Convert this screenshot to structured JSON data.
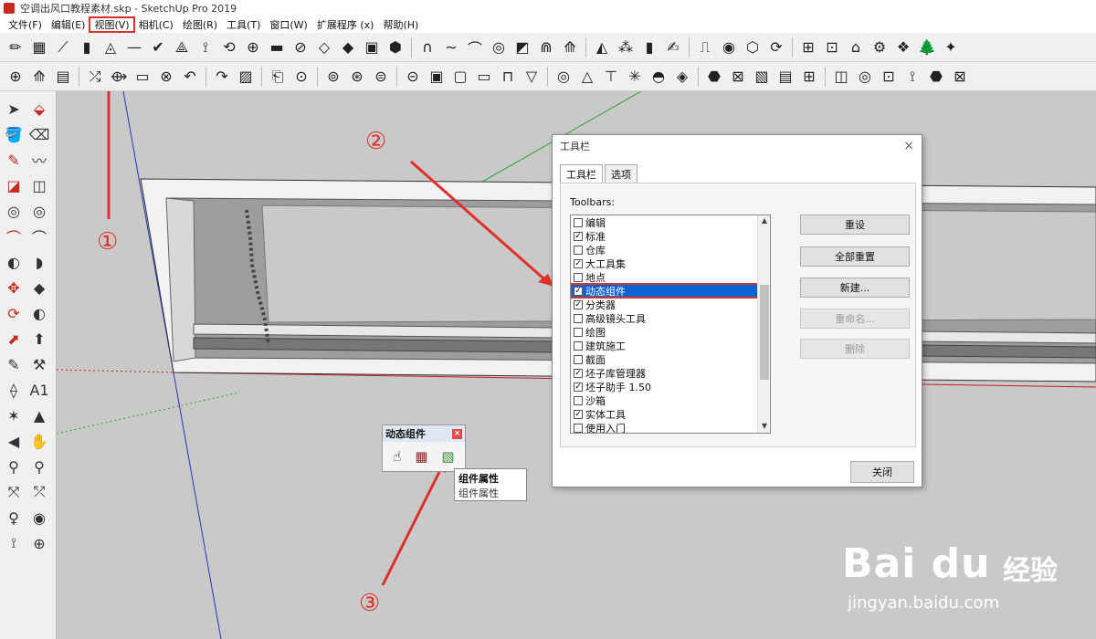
{
  "window": {
    "title": "空调出风口教程素材.skp - SketchUp Pro 2019"
  },
  "menu": {
    "items": [
      "文件(F)",
      "编辑(E)",
      "视图(V)",
      "相机(C)",
      "绘图(R)",
      "工具(T)",
      "窗口(W)",
      "扩展程序 (x)",
      "帮助(H)"
    ],
    "active_index": 2
  },
  "toolbar_row1": [
    "✏",
    "▦",
    "⟋",
    "▮",
    "◬",
    "—",
    "✔",
    "⟁",
    "⟟",
    "⟲",
    "⊕",
    "▬",
    "⊘",
    "◇",
    "◆",
    "▣",
    "⬢",
    "∩",
    "∼",
    "⌒",
    "◎",
    "◩",
    "⋒",
    "⟰",
    "◭",
    "⁂",
    "▮",
    "✍",
    "⎍",
    "◉",
    "⬡",
    "⟳",
    "⊞",
    "⊡",
    "⌂",
    "⚙",
    "❖",
    "🌲",
    "✦"
  ],
  "toolbar_row2": [
    "⊕",
    "⟰",
    "▤",
    "⤮",
    "⟴",
    "▭",
    "⊗",
    "↶",
    "↷",
    "▨",
    "⎗",
    "⊙",
    "⊚",
    "⊛",
    "⊜",
    "⊝",
    "▣",
    "▢",
    "▭",
    "⊓",
    "▽",
    "◎",
    "△",
    "⊤",
    "✳",
    "◓",
    "◈",
    "⬣",
    "⊠",
    "▧",
    "▤",
    "⊞",
    "◫",
    "◎",
    "⊡",
    "⟟",
    "⬣",
    "⊠"
  ],
  "left_tools": [
    "➤",
    "⬙",
    "🪣",
    "⌫",
    "✎",
    "〰",
    "◪",
    "◫",
    "◎",
    "◎",
    "⌒",
    "⌒",
    "◐",
    "◗",
    "✥",
    "◆",
    "⟳",
    "◐",
    "⬈",
    "⬆",
    "✎",
    "⚒",
    "⟠",
    "A1",
    "✶",
    "▲",
    "◀",
    "✋",
    "⚲",
    "⚲",
    "⤧",
    "⤱",
    "♀",
    "◉",
    "⟟",
    "⊕"
  ],
  "dynamic_components": {
    "title": "动态组件",
    "close": "×",
    "icons": [
      "interact-icon",
      "component-options-icon",
      "component-attributes-icon"
    ],
    "tooltip_title": "组件属性",
    "tooltip_desc": "组件属性"
  },
  "dialog": {
    "title": "工具栏",
    "close": "×",
    "tabs": [
      "工具栏",
      "选项"
    ],
    "toolbars_label": "Toolbars:",
    "items": [
      {
        "label": "编辑",
        "checked": false
      },
      {
        "label": "标准",
        "checked": true
      },
      {
        "label": "仓库",
        "checked": false
      },
      {
        "label": "大工具集",
        "checked": true
      },
      {
        "label": "地点",
        "checked": false
      },
      {
        "label": "动态组件",
        "checked": true,
        "selected": true
      },
      {
        "label": "分类器",
        "checked": true
      },
      {
        "label": "高级镜头工具",
        "checked": false
      },
      {
        "label": "绘图",
        "checked": false
      },
      {
        "label": "建筑施工",
        "checked": false
      },
      {
        "label": "截面",
        "checked": false
      },
      {
        "label": "坯子库管理器",
        "checked": true
      },
      {
        "label": "坯子助手 1.50",
        "checked": true
      },
      {
        "label": "沙箱",
        "checked": false
      },
      {
        "label": "实体工具",
        "checked": true
      },
      {
        "label": "使用入门",
        "checked": false
      }
    ],
    "buttons": [
      {
        "label": "重设",
        "enabled": true
      },
      {
        "label": "全部重置",
        "enabled": true
      },
      {
        "label": "新建...",
        "enabled": true
      },
      {
        "label": "重命名...",
        "enabled": false
      },
      {
        "label": "删除",
        "enabled": false
      }
    ],
    "close_button": "关闭"
  },
  "annotations": [
    "①",
    "②",
    "③"
  ],
  "watermark": {
    "logo": "Bai du",
    "cn": "经验",
    "url": "jingyan.baidu.com"
  },
  "colors": {
    "accent_red": "#e0302a",
    "selection_blue": "#0a64d6",
    "axis_green": "#2fa52f",
    "axis_blue": "#3030c0",
    "axis_red": "#c02020"
  }
}
